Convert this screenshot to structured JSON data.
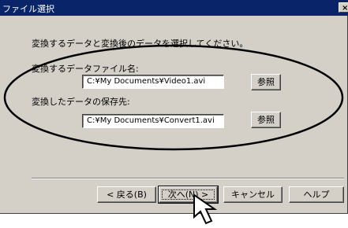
{
  "window": {
    "title": "ファイル選択",
    "close_glyph": "×"
  },
  "instruction": "変換するデータと変換後のデータを選択してください。",
  "source": {
    "label": "変換するデータファイル名:",
    "value": "C:¥My Documents¥Video1.avi",
    "browse_label": "参照"
  },
  "destination": {
    "label": "変換したデータの保存先:",
    "value": "C:¥My Documents¥Convert1.avi",
    "browse_label": "参照"
  },
  "footer": {
    "back_label": "< 戻る(B)",
    "next_label": "次へ(N) >",
    "cancel_label": "キャンセル",
    "help_label": "ヘルプ"
  },
  "annotation": {
    "ellipse_color": "#000000"
  }
}
